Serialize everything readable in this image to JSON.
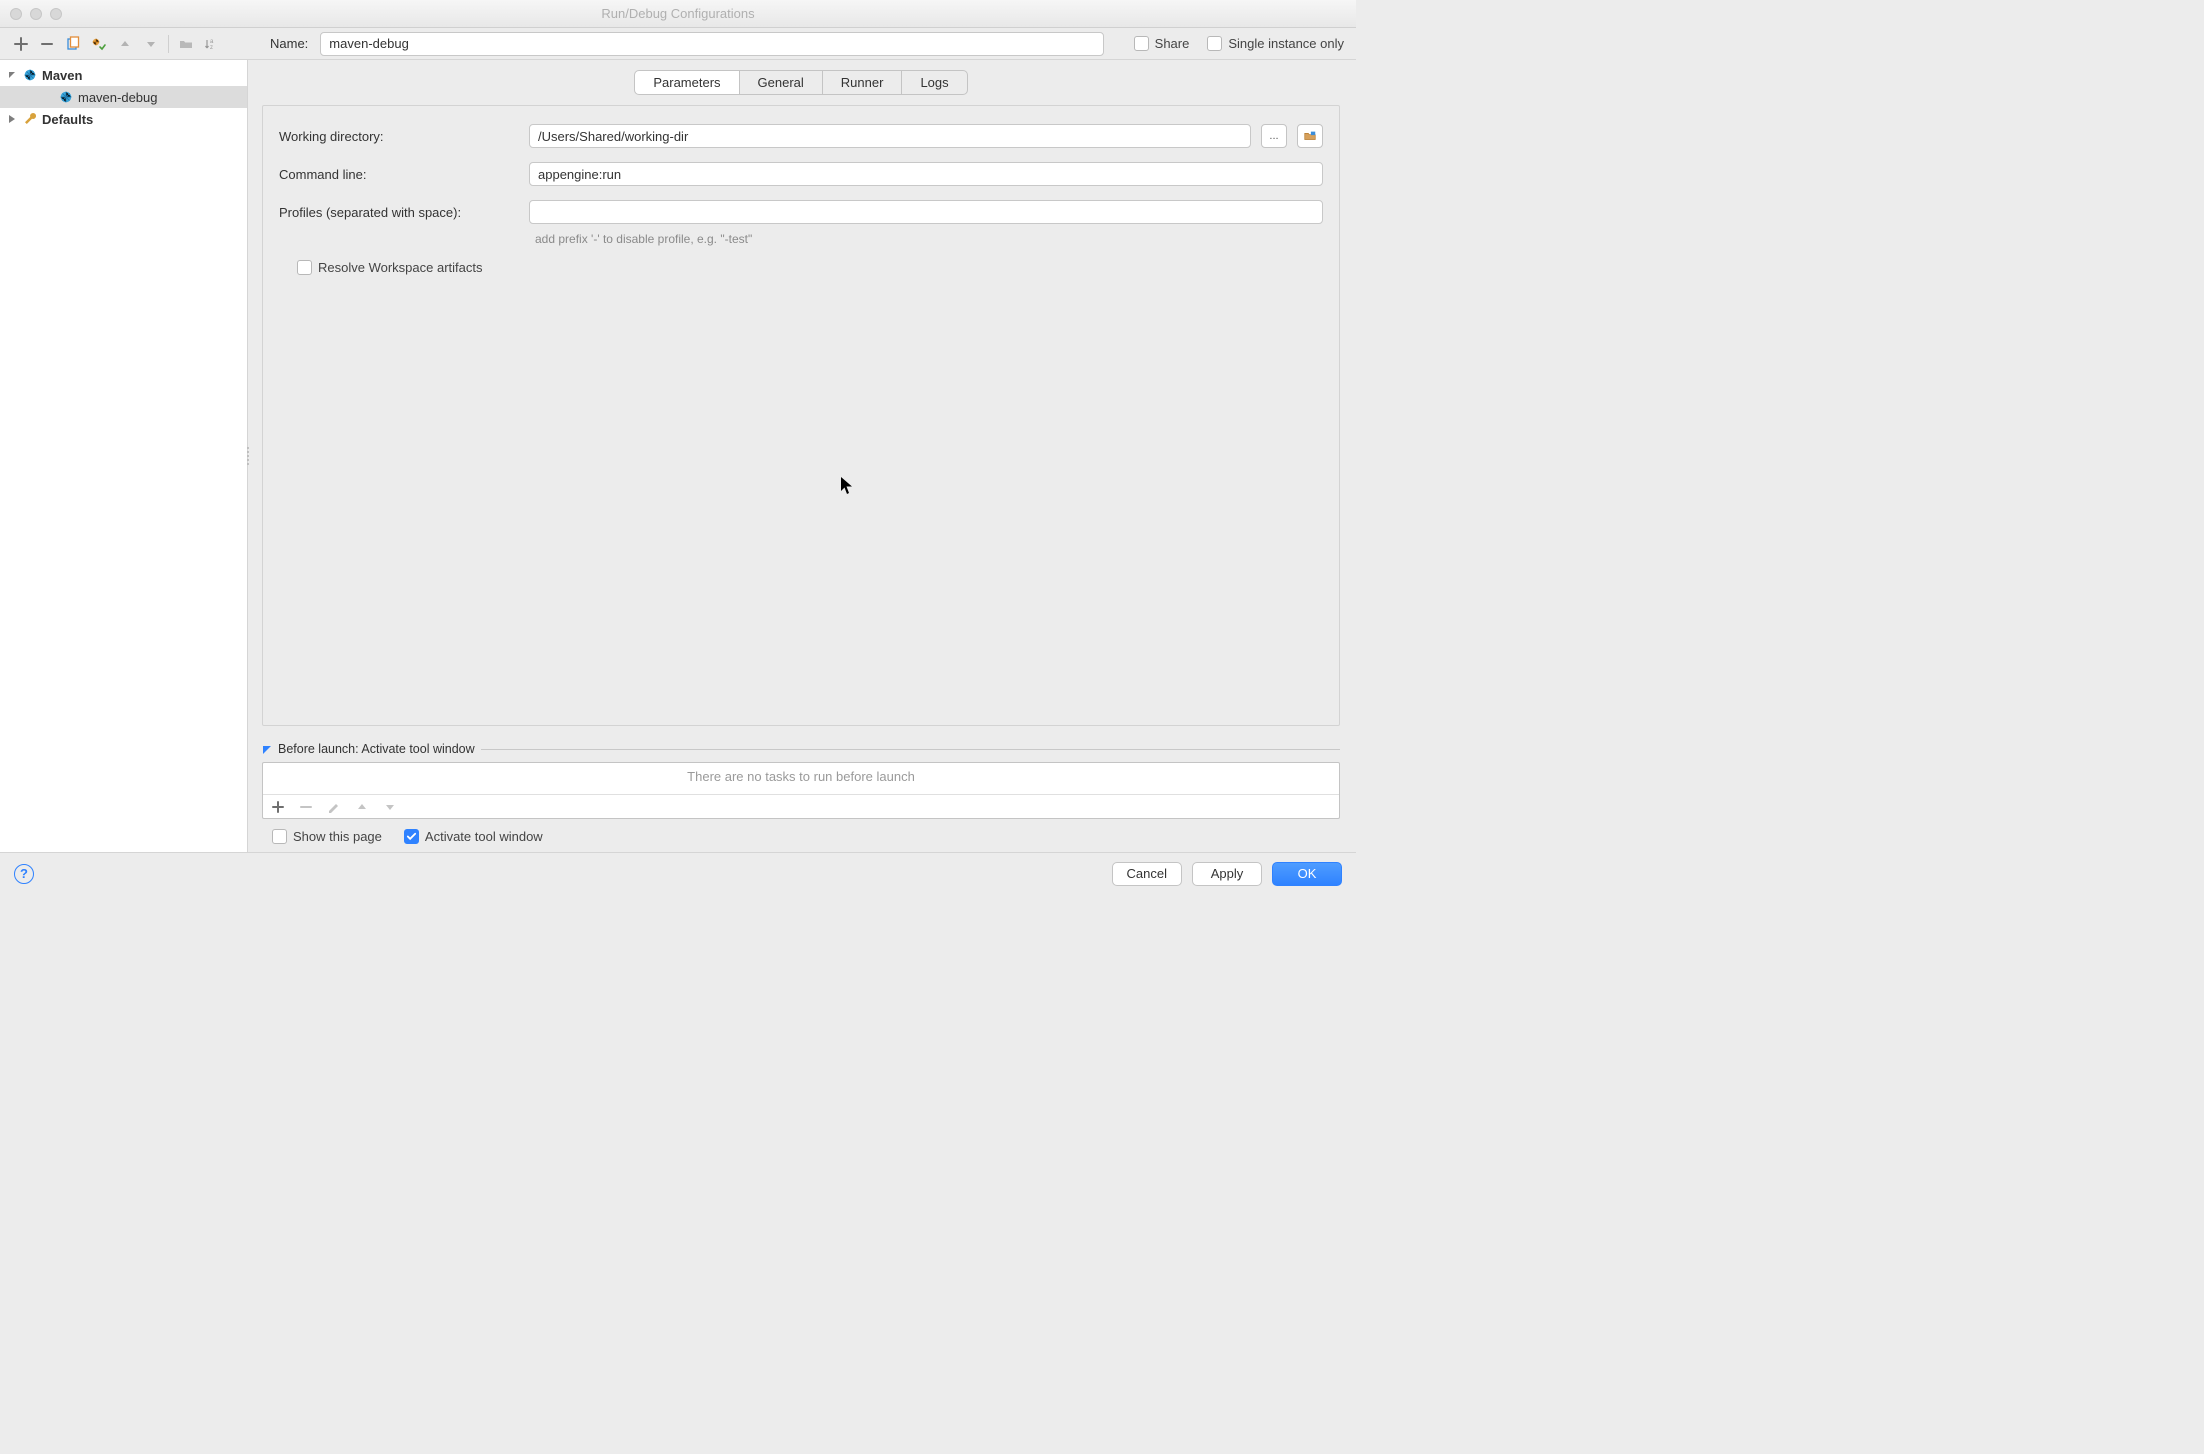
{
  "window": {
    "title": "Run/Debug Configurations"
  },
  "toolbar": {
    "name_label": "Name:",
    "name_value": "maven-debug",
    "share_label": "Share",
    "single_instance_label": "Single instance only"
  },
  "tree": {
    "maven_label": "Maven",
    "maven_debug_label": "maven-debug",
    "defaults_label": "Defaults"
  },
  "tabs": {
    "parameters": "Parameters",
    "general": "General",
    "runner": "Runner",
    "logs": "Logs"
  },
  "parameters": {
    "working_dir_label": "Working directory:",
    "working_dir_value": "/Users/Shared/working-dir",
    "command_line_label": "Command line:",
    "command_line_value": "appengine:run",
    "profiles_label": "Profiles (separated with space):",
    "profiles_value": "",
    "profiles_hint": "add prefix '-' to disable profile, e.g. \"-test\"",
    "resolve_workspace_label": "Resolve Workspace artifacts",
    "ellipsis": "...",
    "folder_icon_title": "browse"
  },
  "before_launch": {
    "title": "Before launch: Activate tool window",
    "empty_msg": "There are no tasks to run before launch",
    "show_page_label": "Show this page",
    "activate_tool_label": "Activate tool window"
  },
  "buttons": {
    "cancel": "Cancel",
    "apply": "Apply",
    "ok": "OK"
  }
}
